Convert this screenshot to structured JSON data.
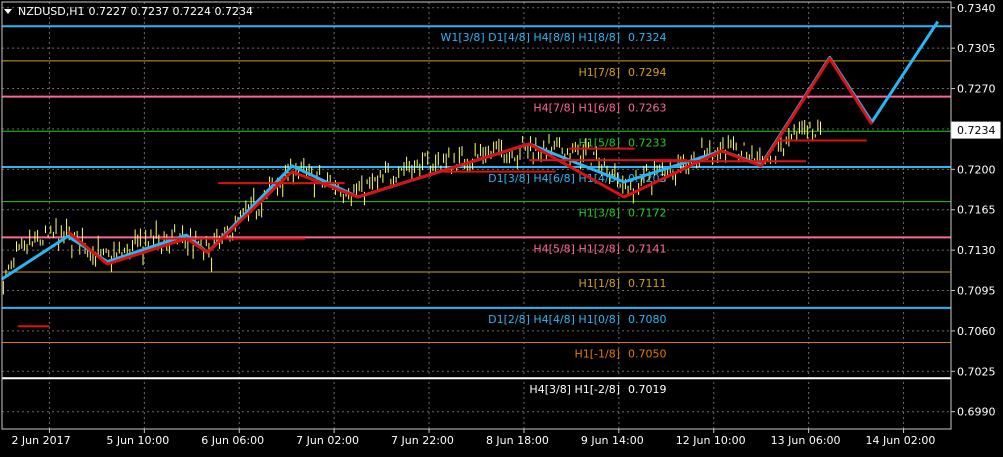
{
  "header": {
    "symbol_timeframe": "NZDUSD,H1",
    "ohlc": "0.7227 0.7237 0.7224 0.7234"
  },
  "colors": {
    "background": "#000000",
    "grid": "#6b6b6b",
    "frame": "#c8c8c8",
    "cyan": "#29b6f6",
    "red": "#e01010",
    "candle": "#ffff66",
    "gold": "#d4a017",
    "pink": "#ff6699",
    "green": "#22cc22",
    "orange": "#e07b00",
    "white": "#ffffff"
  },
  "chart_data": {
    "type": "line",
    "ylim": [
      0.6975,
      0.7345
    ],
    "y_ticks": [
      "0.7340",
      "0.7305",
      "0.7270",
      "0.7235",
      "0.7200",
      "0.7165",
      "0.7130",
      "0.7095",
      "0.7060",
      "0.7025",
      "0.6990"
    ],
    "x_ticks": [
      "2 Jun 2017",
      "5 Jun 10:00",
      "6 Jun 06:00",
      "7 Jun 02:00",
      "7 Jun 22:00",
      "8 Jun 18:00",
      "9 Jun 14:00",
      "12 Jun 10:00",
      "13 Jun 06:00",
      "14 Jun 02:00"
    ],
    "current_price": "0.7234",
    "murrey_levels": [
      {
        "label": "W1[3/8] D1[4/8] H4[8/8] H1[8/8]",
        "value": "0.7324",
        "price": 0.7324,
        "color": "cyan",
        "width": 2
      },
      {
        "label": "H1[7/8]",
        "value": "0.7294",
        "price": 0.7294,
        "color": "gold",
        "width": 1
      },
      {
        "label": "H4[7/8] H1[6/8]",
        "value": "0.7263",
        "price": 0.7263,
        "color": "pink",
        "width": 2
      },
      {
        "label": "H1[5/8]",
        "value": "0.7233",
        "price": 0.7233,
        "color": "green",
        "width": 1
      },
      {
        "label": "D1[3/8] H4[6/8] H1[4/8]",
        "value": "0.7202",
        "price": 0.7202,
        "color": "cyan",
        "width": 2
      },
      {
        "label": "H1[3/8]",
        "value": "0.7172",
        "price": 0.7172,
        "color": "green",
        "width": 1
      },
      {
        "label": "H4[5/8] H1[2/8]",
        "value": "0.7141",
        "price": 0.7141,
        "color": "pink",
        "width": 2
      },
      {
        "label": "H1[1/8]",
        "value": "0.7111",
        "price": 0.7111,
        "color": "gold",
        "width": 1
      },
      {
        "label": "D1[2/8] H4[4/8] H1[0/8]",
        "value": "0.7080",
        "price": 0.708,
        "color": "cyan",
        "width": 2
      },
      {
        "label": "H1[-1/8]",
        "value": "0.7050",
        "price": 0.705,
        "color": "orange",
        "width": 1
      },
      {
        "label": "H4[3/8] H1[-2/8]",
        "value": "0.7019",
        "price": 0.7019,
        "color": "white",
        "width": 2
      }
    ],
    "series": [
      {
        "type": "zigzag",
        "color": "cyan",
        "points": [
          [
            0,
            0.7105
          ],
          [
            25,
            0.7142
          ],
          [
            40,
            0.712
          ],
          [
            70,
            0.7143
          ],
          [
            78,
            0.7128
          ],
          [
            110,
            0.7203
          ],
          [
            135,
            0.7176
          ],
          [
            200,
            0.7222
          ],
          [
            236,
            0.7189
          ],
          [
            273,
            0.7216
          ],
          [
            288,
            0.7204
          ],
          [
            314,
            0.7297
          ],
          [
            330,
            0.7241
          ],
          [
            355,
            0.7328
          ]
        ]
      },
      {
        "type": "zigzag",
        "color": "red",
        "points": [
          [
            25,
            0.7146
          ],
          [
            40,
            0.7118
          ],
          [
            70,
            0.714
          ],
          [
            78,
            0.7128
          ],
          [
            110,
            0.7198
          ],
          [
            135,
            0.7176
          ],
          [
            200,
            0.7222
          ],
          [
            236,
            0.7176
          ],
          [
            273,
            0.7216
          ],
          [
            288,
            0.7203
          ],
          [
            314,
            0.7296
          ],
          [
            330,
            0.7239
          ]
        ]
      },
      {
        "type": "levels",
        "color": "red",
        "segments": [
          [
            6,
            18,
            0.7064
          ],
          [
            60,
            115,
            0.714
          ],
          [
            82,
            130,
            0.7188
          ],
          [
            165,
            210,
            0.7198
          ],
          [
            215,
            240,
            0.7218
          ],
          [
            200,
            260,
            0.7208
          ],
          [
            248,
            305,
            0.7207
          ],
          [
            294,
            328,
            0.7225
          ]
        ]
      }
    ]
  }
}
